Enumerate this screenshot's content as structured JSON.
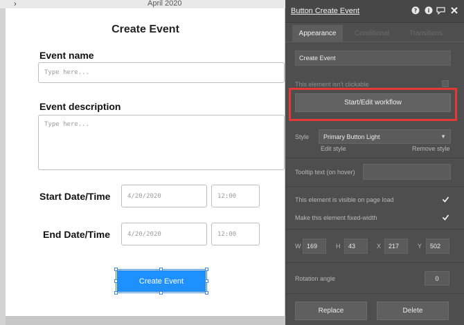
{
  "background": {
    "month_label": "April 2020",
    "chevron": "›"
  },
  "form": {
    "title": "Create Event",
    "event_name_label": "Event name",
    "event_name_placeholder": "Type here...",
    "event_description_label": "Event description",
    "event_description_placeholder": "Type here...",
    "start_label": "Start Date/Time",
    "start_date": "4/20/2020",
    "start_time": "12:00",
    "end_label": "End Date/Time",
    "end_date": "4/20/2020",
    "end_time": "12:00",
    "button_label": "Create Event"
  },
  "panel": {
    "title": "Button Create Event",
    "icons": [
      "help-icon",
      "info-icon",
      "comment-icon",
      "close-icon"
    ],
    "tabs": {
      "appearance": "Appearance",
      "conditional": "Conditional",
      "transitions": "Transitions"
    },
    "element_name": "Create Event",
    "not_clickable_label": "This element isn't clickable",
    "workflow_button": "Start/Edit workflow",
    "style_label": "Style",
    "style_value": "Primary Button Light",
    "edit_style": "Edit style",
    "remove_style": "Remove style",
    "tooltip_label": "Tooltip text (on hover)",
    "visible_label": "This element is visible on page load",
    "visible_checked": true,
    "fixed_width_label": "Make this element fixed-width",
    "fixed_width_checked": true,
    "w_label": "W",
    "w_value": "169",
    "h_label": "H",
    "h_value": "43",
    "x_label": "X",
    "x_value": "217",
    "y_label": "Y",
    "y_value": "502",
    "rotation_label": "Rotation angle",
    "rotation_value": "0",
    "replace_button": "Replace",
    "delete_button": "Delete"
  },
  "colors": {
    "primary": "#1e90ff",
    "highlight": "#e53935",
    "panel_bg": "#4e4e4e"
  }
}
